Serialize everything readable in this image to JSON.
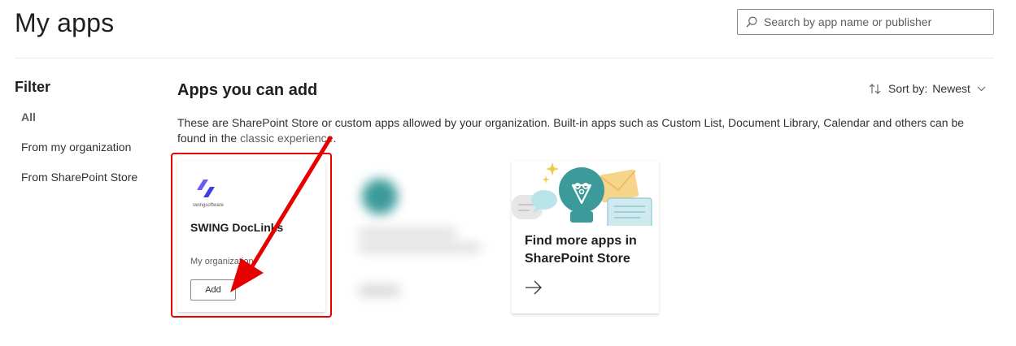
{
  "header": {
    "title": "My apps",
    "search_placeholder": "Search by app name or publisher"
  },
  "filter": {
    "heading": "Filter",
    "items": [
      {
        "label": "All",
        "active": true
      },
      {
        "label": "From my organization",
        "active": false
      },
      {
        "label": "From SharePoint Store",
        "active": false
      }
    ]
  },
  "main": {
    "section_title": "Apps you can add",
    "sort": {
      "label": "Sort by:",
      "value": "Newest"
    },
    "description": "These are SharePoint Store or custom apps allowed by your organization. Built-in apps such as Custom List, Document Library, Calendar and others can be found in the ",
    "classic_link": "classic experience",
    "description_end": "."
  },
  "cards": {
    "app": {
      "logo_text": "swingsoftware",
      "name": "SWING DocLinks",
      "publisher": "My organization",
      "add_label": "Add"
    },
    "store": {
      "line1": "Find more apps in",
      "line2": "SharePoint Store"
    }
  },
  "colors": {
    "annotation": "#e60000",
    "logo": "#4b4bf0",
    "teal": "#3c9a9a"
  }
}
